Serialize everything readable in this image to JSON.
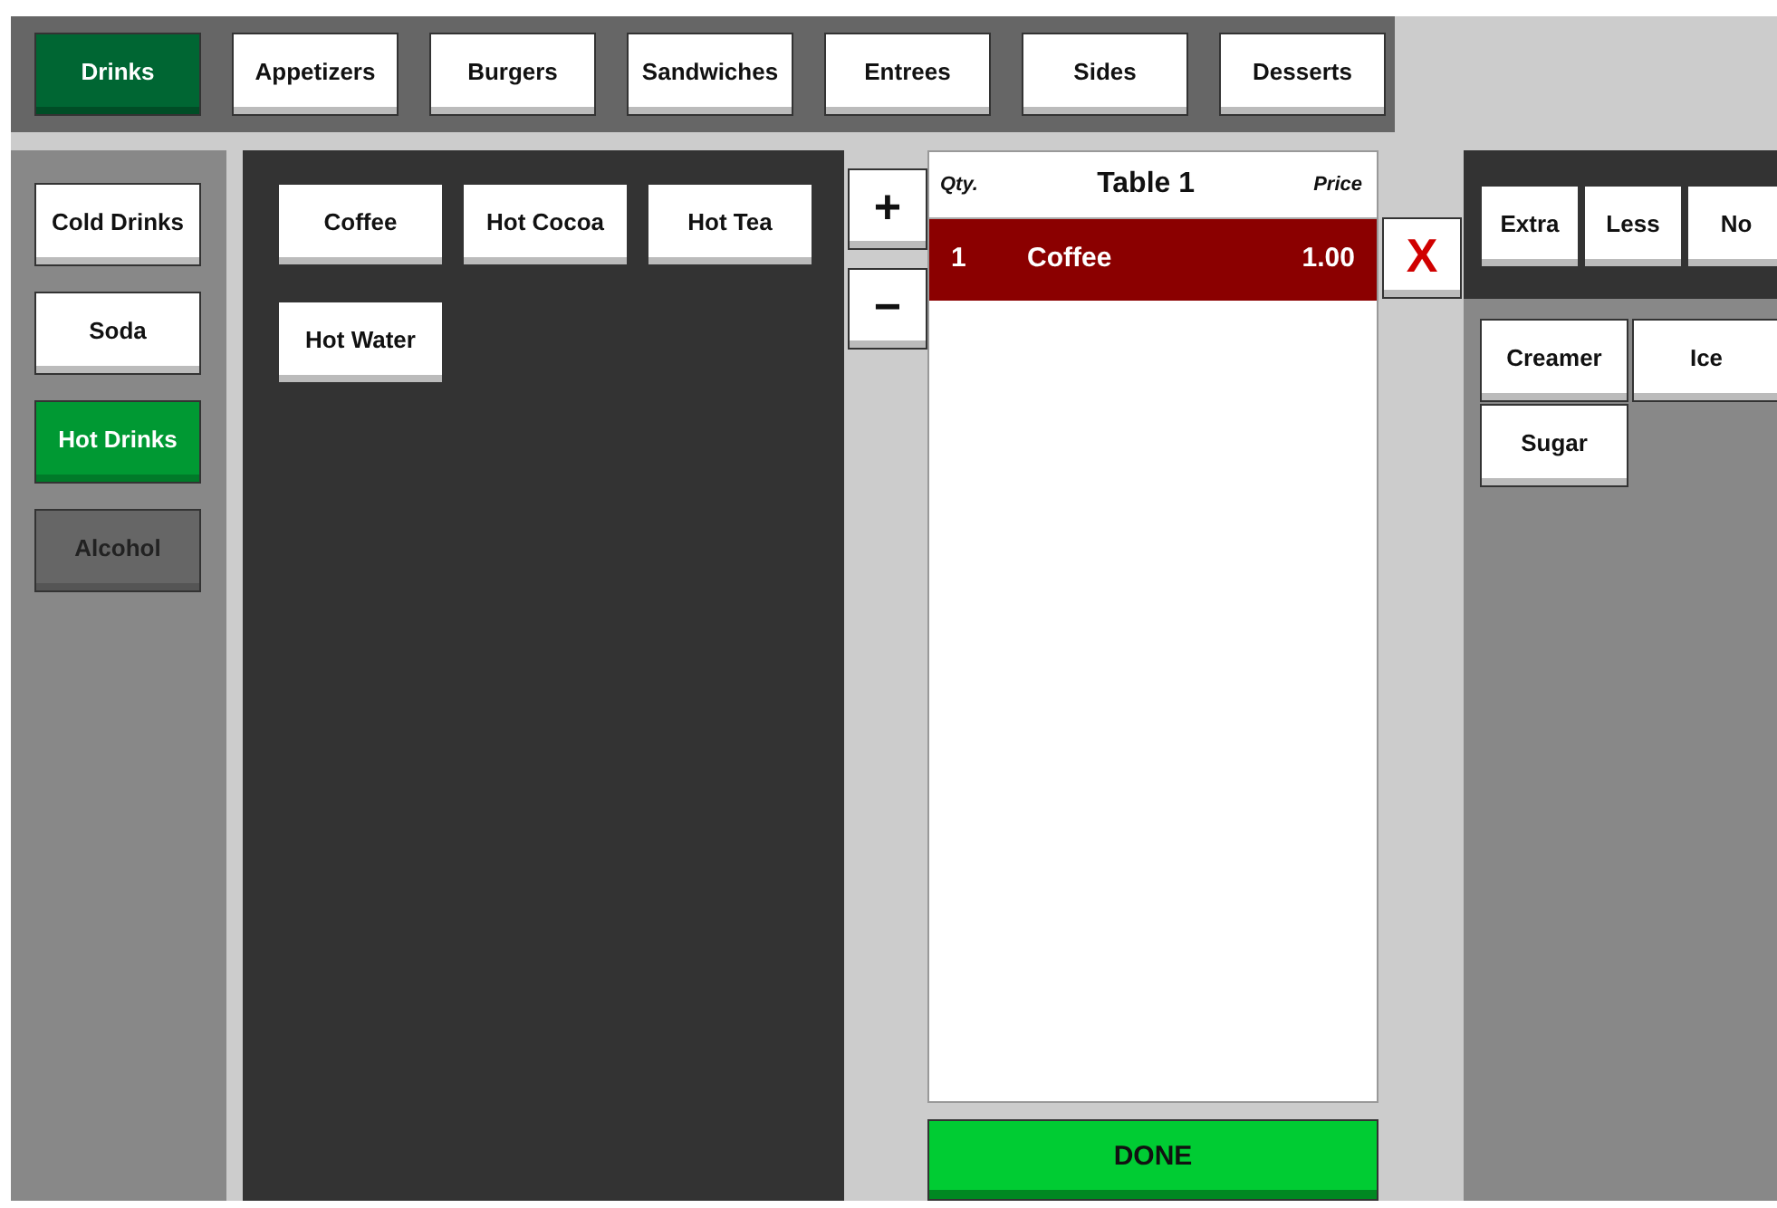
{
  "categories": [
    {
      "label": "Drinks",
      "selected": true
    },
    {
      "label": "Appetizers",
      "selected": false
    },
    {
      "label": "Burgers",
      "selected": false
    },
    {
      "label": "Sandwiches",
      "selected": false
    },
    {
      "label": "Entrees",
      "selected": false
    },
    {
      "label": "Sides",
      "selected": false
    },
    {
      "label": "Desserts",
      "selected": false
    }
  ],
  "subcategories": [
    {
      "label": "Cold Drinks",
      "selected": false,
      "disabled": false
    },
    {
      "label": "Soda",
      "selected": false,
      "disabled": false
    },
    {
      "label": "Hot Drinks",
      "selected": true,
      "disabled": false
    },
    {
      "label": "Alcohol",
      "selected": false,
      "disabled": true
    }
  ],
  "items": [
    {
      "label": "Coffee"
    },
    {
      "label": "Hot Cocoa"
    },
    {
      "label": "Hot Tea"
    },
    {
      "label": "Hot Water"
    }
  ],
  "qty_buttons": {
    "increase": "+",
    "decrease": "−"
  },
  "order": {
    "qty_header": "Qty.",
    "title": "Table 1",
    "price_header": "Price",
    "rows": [
      {
        "qty": "1",
        "name": "Coffee",
        "price": "1.00",
        "selected": true
      }
    ]
  },
  "remove_button": "X",
  "done_button": "DONE",
  "modifier_types": [
    {
      "label": "Extra"
    },
    {
      "label": "Less"
    },
    {
      "label": "No"
    }
  ],
  "modifiers": [
    {
      "label": "Creamer"
    },
    {
      "label": "Ice"
    },
    {
      "label": "Sugar"
    }
  ]
}
